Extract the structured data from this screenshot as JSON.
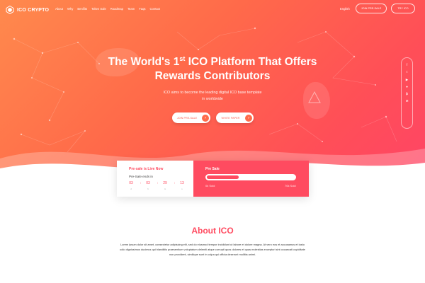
{
  "brand": {
    "name": "ICO CRYPTO"
  },
  "nav": {
    "items": [
      "About",
      "Why",
      "Benifits",
      "Token Sale",
      "Roadmap",
      "Team",
      "Faqs",
      "Contact"
    ]
  },
  "header": {
    "language": "English",
    "join_presale": "JOIN PRE-SALE",
    "try_ico": "TRY ICO"
  },
  "hero": {
    "headline_line1_before": "The World's 1",
    "headline_sup": "st",
    "headline_line1_after": " ICO Platform That Offers",
    "headline_line2": "Rewards Contributors",
    "subtext": "ICO aims to become the leading digital ICO base template in worldwide",
    "buttons": {
      "join": "JOIN PRE-SALE",
      "whitepaper": "WHITE PAPER"
    }
  },
  "social": {
    "icons": [
      "facebook-icon",
      "twitter-icon",
      "youtube-icon",
      "github-icon",
      "bitcoin-icon",
      "medium-icon"
    ]
  },
  "presale": {
    "live_label": "Pre-sale is Live Now",
    "ends_label": "Pre-Sale ends in",
    "countdown": [
      {
        "value": "03",
        "unit": "d"
      },
      {
        "value": "03",
        "unit": "h"
      },
      {
        "value": "29",
        "unit": "m"
      },
      {
        "value": "13",
        "unit": "s"
      }
    ],
    "sale_label": "Pre Sale",
    "sold_left": "0k Sold",
    "sold_right": "70k Sold",
    "progress": 0.36
  },
  "about": {
    "title": "About ICO",
    "text": "Lorem ipsum dolor sit amet, consectetur adipiscing elit, sed do eiusmod tempor incididunt ut labore et dolore magna. At vero eos et accusamus et iusto odio dignissimos ducimus qui blanditiis praesentium voluptatum deleniti atque corrupti quos dolores et quas molestias excepturi sint occaecati cupiditate non provident, similique sunt in culpa qui officia deserunt mollitia animi."
  },
  "colors": {
    "accent": "#ff4b60",
    "hero_start": "#ff8a4d",
    "hero_end": "#ff4466"
  }
}
